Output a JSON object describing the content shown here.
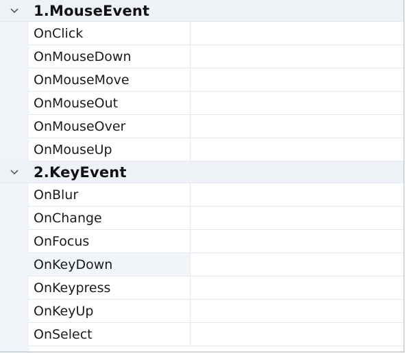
{
  "groups": [
    {
      "title": "1.MouseEvent",
      "items": [
        {
          "name": "OnClick",
          "value": ""
        },
        {
          "name": "OnMouseDown",
          "value": ""
        },
        {
          "name": "OnMouseMove",
          "value": ""
        },
        {
          "name": "OnMouseOut",
          "value": ""
        },
        {
          "name": "OnMouseOver",
          "value": ""
        },
        {
          "name": "OnMouseUp",
          "value": ""
        }
      ]
    },
    {
      "title": "2.KeyEvent",
      "items": [
        {
          "name": "OnBlur",
          "value": ""
        },
        {
          "name": "OnChange",
          "value": ""
        },
        {
          "name": "OnFocus",
          "value": ""
        },
        {
          "name": "OnKeyDown",
          "value": ""
        },
        {
          "name": "OnKeypress",
          "value": ""
        },
        {
          "name": "OnKeyUp",
          "value": ""
        },
        {
          "name": "OnSelect",
          "value": ""
        }
      ]
    }
  ],
  "icons": {
    "collapse": "chevron-down-icon"
  }
}
